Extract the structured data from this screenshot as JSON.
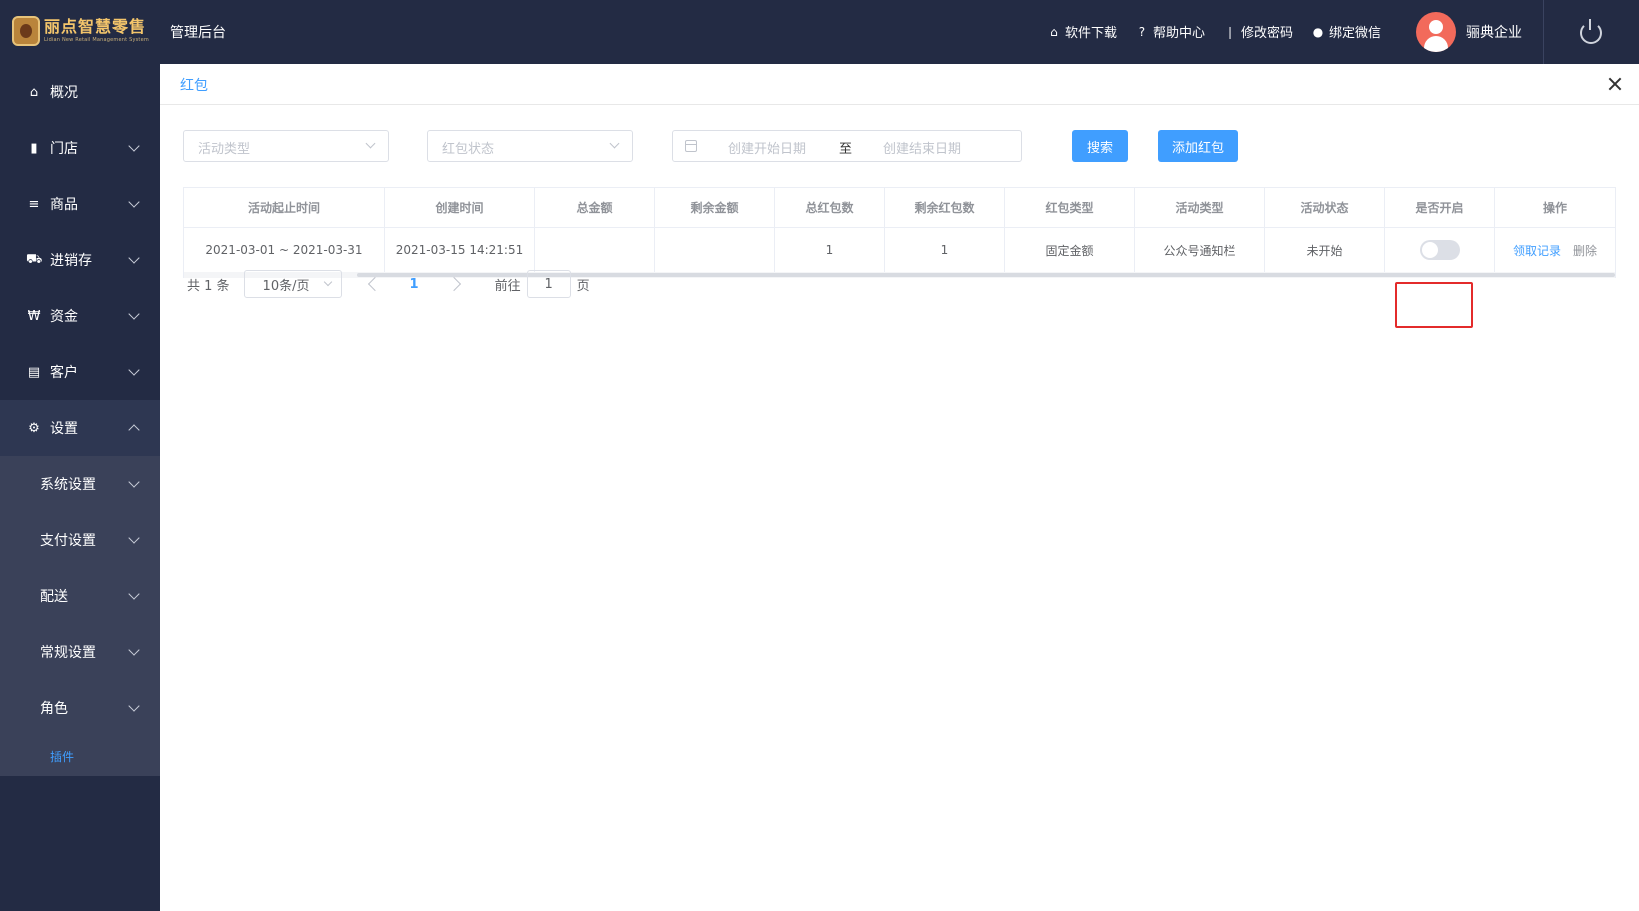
{
  "header": {
    "logo_title": "丽点智慧零售",
    "logo_subtitle": "Lidian New Retail Management System",
    "admin_title": "管理后台",
    "links": [
      {
        "icon": "store-icon",
        "label": "软件下载"
      },
      {
        "icon": "question-circle-icon",
        "label": "帮助中心"
      },
      {
        "icon": "thermometer-icon",
        "label": "修改密码"
      },
      {
        "icon": "chat-icon",
        "label": "绑定微信"
      }
    ],
    "user_name": "骊典企业",
    "avatar_color": "#f26a5b"
  },
  "sidebar": {
    "items": [
      {
        "label": "概况",
        "icon": "home-icon",
        "glyph": "⌂"
      },
      {
        "label": "门店",
        "icon": "store-door-icon",
        "glyph": "▮"
      },
      {
        "label": "商品",
        "icon": "list-icon",
        "glyph": "≡"
      },
      {
        "label": "进销存",
        "icon": "truck-icon",
        "glyph": "⛟"
      },
      {
        "label": "资金",
        "icon": "won-icon",
        "glyph": "₩"
      },
      {
        "label": "客户",
        "icon": "id-card-icon",
        "glyph": "▤"
      },
      {
        "label": "设置",
        "icon": "gear-icon",
        "glyph": "⚙"
      }
    ],
    "sub_items": [
      {
        "label": "系统设置"
      },
      {
        "label": "支付设置"
      },
      {
        "label": "配送"
      },
      {
        "label": "常规设置"
      },
      {
        "label": "角色"
      }
    ],
    "plugin_label": "插件"
  },
  "tab": {
    "title": "红包"
  },
  "filters": {
    "activity_type_placeholder": "活动类型",
    "status_placeholder": "红包状态",
    "start_date_placeholder": "创建开始日期",
    "range_separator": "至",
    "end_date_placeholder": "创建结束日期",
    "search_label": "搜索",
    "add_label": "添加红包"
  },
  "table": {
    "columns": [
      "活动起止时间",
      "创建时间",
      "总金额",
      "剩余金额",
      "总红包数",
      "剩余红包数",
      "红包类型",
      "活动类型",
      "活动状态",
      "是否开启",
      "操作"
    ],
    "row": {
      "period": "2021-03-01 ~ 2021-03-31",
      "created": "2021-03-15 14:21:51",
      "total_amount": "",
      "remaining_amount": "",
      "total_count": "1",
      "remaining_count": "1",
      "packet_type": "固定金额",
      "activity_type": "公众号通知栏",
      "activity_status": "未开始",
      "enabled": false,
      "action_records": "领取记录",
      "action_delete": "删除"
    }
  },
  "pagination": {
    "total_text": "共 1 条",
    "page_size": "10条/页",
    "current_page": "1",
    "goto_label": "前往",
    "goto_value": "1",
    "goto_unit": "页"
  },
  "colors": {
    "accent": "#409eff",
    "sidebar_bg": "#232b44",
    "highlight": "#e32b2b"
  }
}
